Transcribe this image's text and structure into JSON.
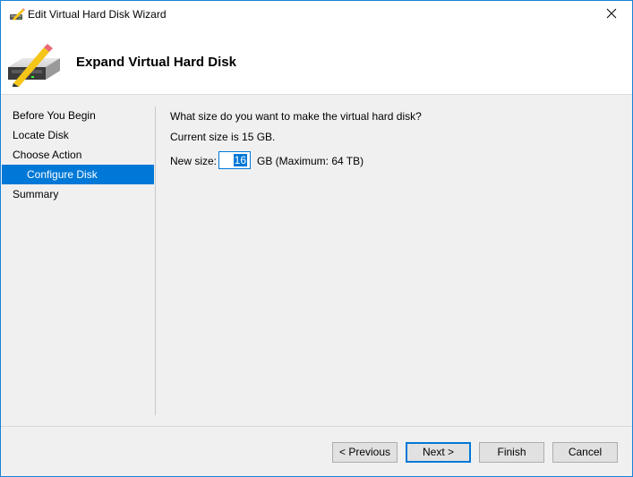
{
  "window": {
    "title": "Edit Virtual Hard Disk Wizard",
    "title_icon": "disk-edit-icon",
    "close_icon": "close-icon"
  },
  "header": {
    "title": "Expand Virtual Hard Disk",
    "icon": "hard-disk-pencil-icon"
  },
  "nav": {
    "items": [
      {
        "label": "Before You Begin",
        "active": false,
        "sub": false
      },
      {
        "label": "Locate Disk",
        "active": false,
        "sub": false
      },
      {
        "label": "Choose Action",
        "active": false,
        "sub": false
      },
      {
        "label": "Configure Disk",
        "active": true,
        "sub": true
      },
      {
        "label": "Summary",
        "active": false,
        "sub": false
      }
    ]
  },
  "content": {
    "question": "What size do you want to make the virtual hard disk?",
    "current_size": "Current size is 15 GB.",
    "new_size_label": "New size:",
    "new_size_value": "16",
    "unit_hint": "GB (Maximum: 64 TB)"
  },
  "buttons": {
    "previous": "< Previous",
    "next": "Next >",
    "finish": "Finish",
    "cancel": "Cancel"
  },
  "colors": {
    "accent": "#0078d7",
    "window_border": "#1883d7"
  }
}
